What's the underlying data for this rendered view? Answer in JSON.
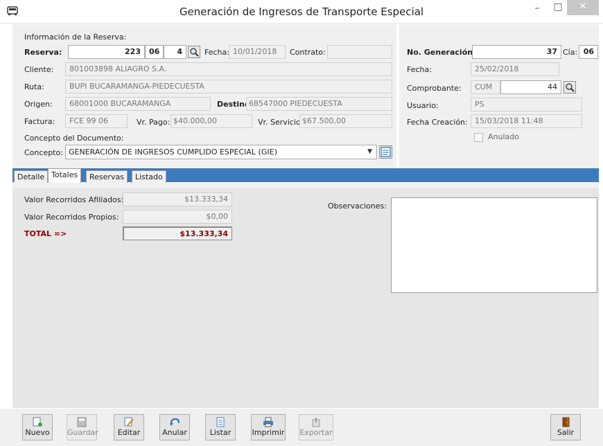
{
  "window": {
    "title": "Generación de Ingresos de Transporte Especial",
    "min_symbol": "–",
    "max_symbol": "□",
    "close_symbol": "✕"
  },
  "reserva_info": {
    "section_label": "Información de la Reserva:",
    "reserva_label": "Reserva:",
    "reserva_num": "223",
    "reserva_part2": "06",
    "reserva_part3": "4",
    "fecha_label": "Fecha:",
    "fecha_value": "10/01/2018",
    "contrato_label": "Contrato:",
    "contrato_value": "",
    "cliente_label": "Cliente:",
    "cliente_value": "801003898 ALIAGRO S.A.",
    "ruta_label": "Ruta:",
    "ruta_value": "BUPI BUCARAMANGA-PIEDECUESTA",
    "origen_label": "Origen:",
    "origen_value": "68001000 BUCARAMANGA",
    "destino_label": "Destino:",
    "destino_value": "68547000 PIEDECUESTA",
    "factura_label": "Factura:",
    "factura_value": "FCE 99 06",
    "vr_pago_label": "Vr. Pago:",
    "vr_pago_value": "$40.000,00",
    "vr_servicio_label": "Vr. Servicio:",
    "vr_servicio_value": "$67.500,00",
    "concepto_doc_label": "Concepto del Documento:",
    "concepto_label": "Concepto:",
    "concepto_value": "GENERACIÓN DE INGRESOS CUMPLIDO ESPECIAL (GIE)"
  },
  "generacion": {
    "no_generacion_label": "No. Generación",
    "no_generacion_value": "37",
    "cia_label": "Cía:",
    "cia_value": "06",
    "fecha_label": "Fecha:",
    "fecha_value": "25/02/2018",
    "comprobante_label": "Comprobante:",
    "comprobante_type": "CUM",
    "comprobante_num": "44",
    "usuario_label": "Usuario:",
    "usuario_value": "PS",
    "fecha_creacion_label": "Fecha Creación:",
    "fecha_creacion_value": "15/03/2018 11:48",
    "anulado_label": "Anulado"
  },
  "tabs": [
    {
      "label": "Detalle"
    },
    {
      "label": "Totales"
    },
    {
      "label": "Reservas"
    },
    {
      "label": "Listado"
    }
  ],
  "totales": {
    "afiliados_label": "Valor Recorridos Afiliados:",
    "afiliados_value": "$13.333,34",
    "propios_label": "Valor Recorridos Propios:",
    "propios_value": "$0,00",
    "total_label": "TOTAL =>",
    "total_value": "$13.333,34",
    "observaciones_label": "Observaciones:",
    "observaciones_value": ""
  },
  "toolbar": {
    "nuevo": "Nuevo",
    "guardar": "Guardar",
    "editar": "Editar",
    "anular": "Anular",
    "listar": "Listar",
    "imprimir": "Imprimir",
    "exportar": "Exportar",
    "salir": "Salir"
  },
  "colors": {
    "tab_strip": "#3c7bbd",
    "total_text": "#8b0000"
  }
}
